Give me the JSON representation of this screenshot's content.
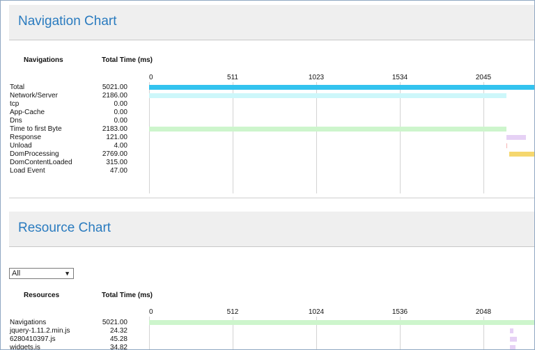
{
  "navigation": {
    "title": "Navigation Chart",
    "col_name": "Navigations",
    "col_time": "Total Time (ms)",
    "ticks": [
      "0",
      "511",
      "1023",
      "1534",
      "2045"
    ],
    "rows": [
      {
        "label": "Total",
        "value": "5021.00",
        "start": 0,
        "duration": 5021,
        "color": "#33c3ef"
      },
      {
        "label": "Network/Server",
        "value": "2186.00",
        "start": 0,
        "duration": 2186,
        "color": "#cdf7fa"
      },
      {
        "label": "tcp",
        "value": "0.00",
        "start": 0,
        "duration": 0,
        "color": "#cdf7fa"
      },
      {
        "label": "App-Cache",
        "value": "0.00",
        "start": 0,
        "duration": 0,
        "color": "#cdf7fa"
      },
      {
        "label": "Dns",
        "value": "0.00",
        "start": 0,
        "duration": 0,
        "color": "#cdf7fa"
      },
      {
        "label": "Time to first Byte",
        "value": "2183.00",
        "start": 0,
        "duration": 2183,
        "color": "#cdf5cc"
      },
      {
        "label": "Response",
        "value": "121.00",
        "start": 2183,
        "duration": 121,
        "color": "#e6d1f5"
      },
      {
        "label": "Unload",
        "value": "4.00",
        "start": 2185,
        "duration": 4,
        "color": "#f4b4b4"
      },
      {
        "label": "DomProcessing",
        "value": "2769.00",
        "start": 2200,
        "duration": 2769,
        "color": "#f5d76e"
      },
      {
        "label": "DomContentLoaded",
        "value": "315.00",
        "start": 0,
        "duration": 0,
        "color": "#f5d76e"
      },
      {
        "label": "Load Event",
        "value": "47.00",
        "start": 0,
        "duration": 0,
        "color": "#f5d76e"
      }
    ]
  },
  "resource": {
    "title": "Resource Chart",
    "filter_value": "All",
    "col_name": "Resources",
    "col_time": "Total Time (ms)",
    "ticks": [
      "0",
      "512",
      "1024",
      "1536",
      "2048"
    ],
    "rows": [
      {
        "label": "Navigations",
        "value": "5021.00",
        "start": 0,
        "duration": 5021,
        "color": "#cdf5cc"
      },
      {
        "label": "jquery-1.11.2.min.js",
        "value": "24.32",
        "start": 2208,
        "duration": 24,
        "color": "#e6d1f5"
      },
      {
        "label": "6280410397.js",
        "value": "45.28",
        "start": 2208,
        "duration": 45,
        "color": "#e6d1f5"
      },
      {
        "label": "widgets.js",
        "value": "34.82",
        "start": 2208,
        "duration": 35,
        "color": "#e6d1f5"
      }
    ]
  }
}
